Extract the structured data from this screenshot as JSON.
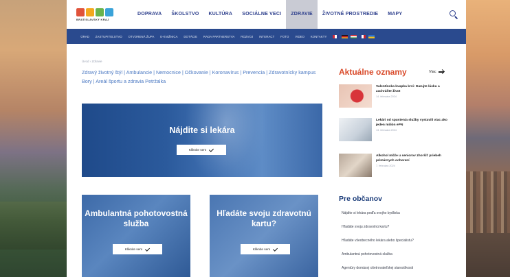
{
  "logo": {
    "text": "BRATISLAVSKÝ KRAJ"
  },
  "mainnav": {
    "items": [
      "DOPRAVA",
      "ŠKOLSTVO",
      "KULTÚRA",
      "SOCIÁLNE VECI",
      "ZDRAVIE",
      "ŽIVOTNÉ PROSTREDIE",
      "MAPY"
    ],
    "active": "ZDRAVIE"
  },
  "subnav": {
    "items": [
      "ÚRAD",
      "ZASTUPITEĽSTVO",
      "OTVORENÁ ŽUPA",
      "E-KNIŽNICA",
      "DOTÁCIE",
      "RADA PARTNERSTVA",
      "ROZVOJ",
      "INTERACT",
      "FOTO",
      "VIDEO",
      "KONTAKTY"
    ]
  },
  "breadcrumb": "Úvod › Zdravie",
  "tags": "Zdravý životný štýl | Ambulancie | Nemocnice | Očkovanie | Koronavírus | Prevencia | Zdravotnícky kampus Bory | Areál športu a zdravia Petržalka",
  "hero": {
    "title": "Nájdite si lekára",
    "cta": "Kliknite sem"
  },
  "cards": [
    {
      "title": "Ambulantná pohotovostná služba",
      "cta": "Kliknite sem"
    },
    {
      "title": "Hľadáte svoju zdravotnú kartu?",
      "cta": "Kliknite sem"
    }
  ],
  "news": {
    "title": "Aktuálne oznamy",
    "more": "Viac",
    "items": [
      {
        "headline": "Valentínska kvapka krvi: Darujte lásku a zachráňte život",
        "date": "14. februára 2024"
      },
      {
        "headline": "Lekári od spustenia služby vystavili viac ako jeden milión ePN",
        "date": "13. februára 2024"
      },
      {
        "headline": "Alkohol môže u seniorov zhoršiť priebeh primárnych ochorení",
        "date": "7. februára 2024"
      }
    ]
  },
  "citizens": {
    "title": "Pre občanov",
    "items": [
      "Nájdite si lekára podľa svojho bydliska",
      "Hľadáte svoju zdravotnú kartu?",
      "Hľadáte všeobecného lekára alebo špecialistu?",
      "Ambulantná pohotovostná služba",
      "Agentúry domácej ošetrovateľskej starostlivosti"
    ]
  },
  "colors": {
    "primary": "#2a4a8e",
    "accent": "#d94b2b",
    "link": "#4a78c2"
  }
}
